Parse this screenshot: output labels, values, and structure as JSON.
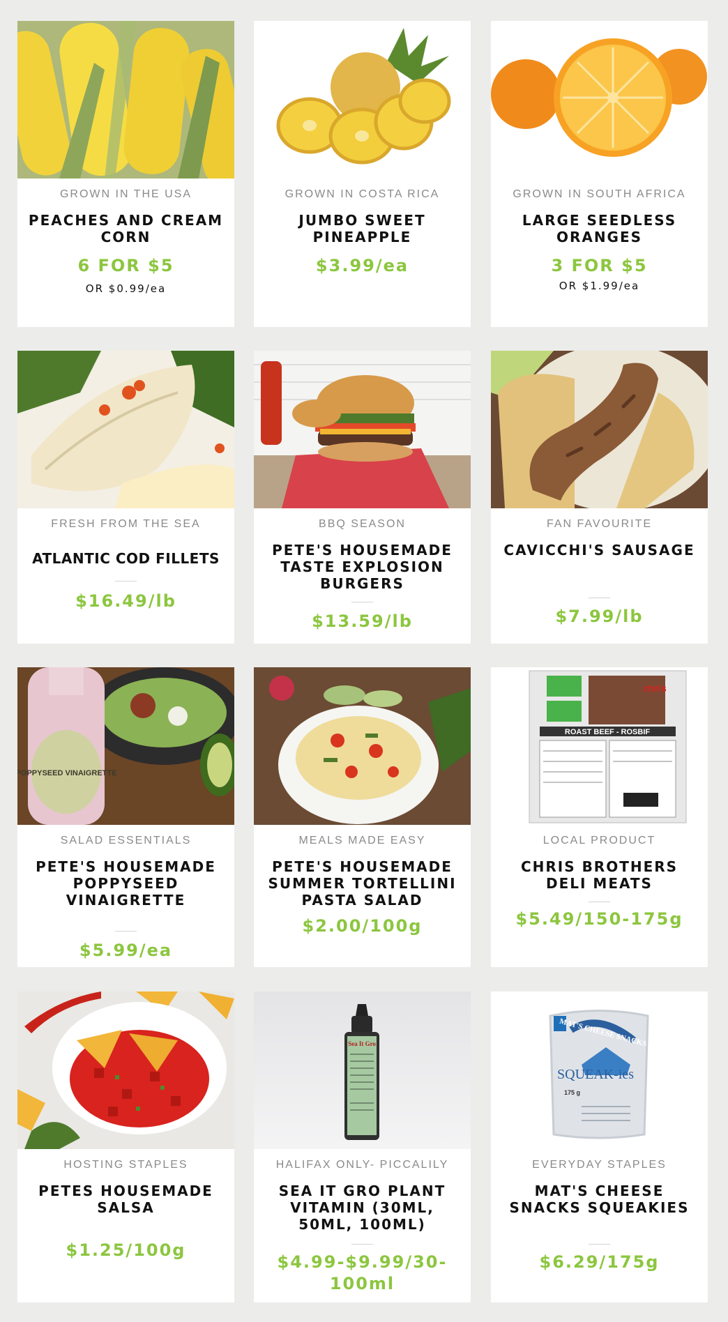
{
  "colors": {
    "background": "#ececea",
    "card": "#ffffff",
    "price": "#8cc63f",
    "origin": "#8a8a8a",
    "title": "#111111"
  },
  "products": [
    {
      "origin": "GROWN IN THE USA",
      "title": "PEACHES AND CREAM CORN",
      "price": "6 FOR $5",
      "sub": "OR $0.99/ea",
      "image": "corn-photo"
    },
    {
      "origin": "GROWN IN COSTA RICA",
      "title": "JUMBO SWEET PINEAPPLE",
      "price": "$3.99/ea",
      "image": "pineapple-photo"
    },
    {
      "origin": "GROWN IN SOUTH AFRICA",
      "title": "LARGE SEEDLESS ORANGES",
      "price": "3 FOR $5",
      "sub": "OR $1.99/ea",
      "image": "oranges-photo"
    },
    {
      "origin": "FRESH FROM THE SEA",
      "title": "ATLANTIC COD FILLETS",
      "price": "$16.49/lb",
      "image": "cod-fillet-photo"
    },
    {
      "origin": "BBQ SEASON",
      "title": "PETE'S HOUSEMADE TASTE EXPLOSION BURGERS",
      "price": "$13.59/lb",
      "image": "burger-photo"
    },
    {
      "origin": "FAN FAVOURITE",
      "title": "CAVICCHI'S SAUSAGE",
      "price": "$7.99/lb",
      "image": "sausage-photo"
    },
    {
      "origin": "SALAD ESSENTIALS",
      "title": "PETE'S HOUSEMADE POPPYSEED VINAIGRETTE",
      "price": "$5.99/ea",
      "image": "vinaigrette-photo"
    },
    {
      "origin": "MEALS MADE EASY",
      "title": "PETE'S HOUSEMADE SUMMER TORTELLINI PASTA SALAD",
      "price": "$2.00/100g",
      "image": "pasta-salad-photo"
    },
    {
      "origin": "LOCAL PRODUCT",
      "title": "CHRIS BROTHERS DELI MEATS",
      "price": "$5.49/150-175g",
      "image": "deli-meat-package-photo"
    },
    {
      "origin": "HOSTING STAPLES",
      "title": "PETES HOUSEMADE SALSA",
      "price": "$1.25/100g",
      "image": "salsa-photo"
    },
    {
      "origin": "HALIFAX ONLY- PICCALILY",
      "title": "SEA IT GRO PLANT VITAMIN (30ml, 50ml, 100ml)",
      "price": "$4.99-$9.99/30-100ml",
      "image": "plant-vitamin-bottle-photo"
    },
    {
      "origin": "EVERYDAY STAPLES",
      "title": "MAT'S CHEESE SNACKS SQUEAKIES",
      "price": "$6.29/175g",
      "image": "cheese-curds-bag-photo"
    }
  ],
  "image_text": {
    "vinaigrette_label": "POPPYSEED VINAIGRETTE",
    "deli_package": "ROAST BEEF - ROSBIF",
    "deli_brand": "chris",
    "vitamin_label": "Sea It Gro",
    "cheese_brand": "MAT'S CHEESE SNACKS",
    "cheese_product": "SQUEAK-ies",
    "cheese_weight": "175 g"
  }
}
